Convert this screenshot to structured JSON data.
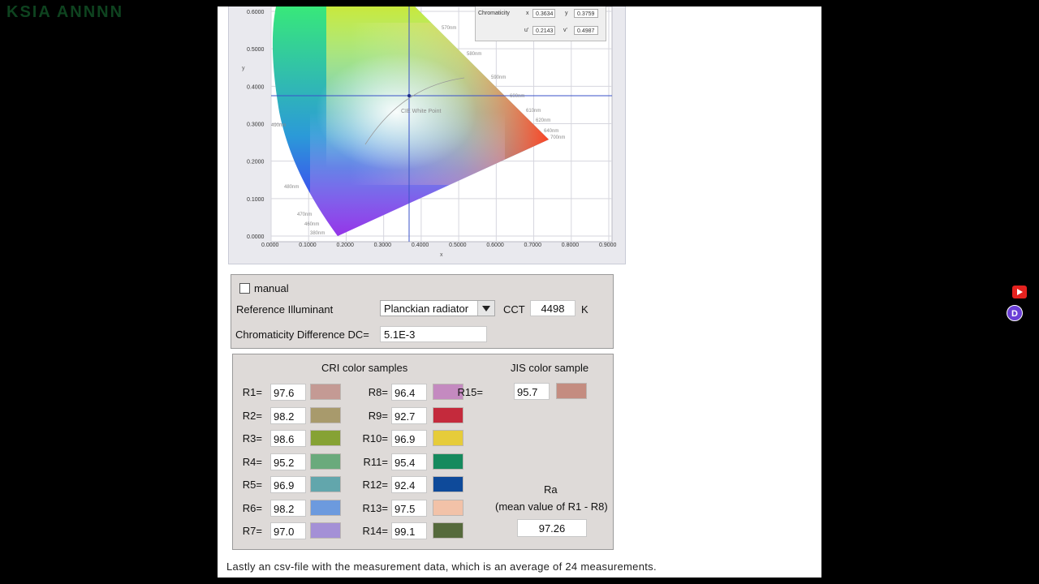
{
  "overlay": {
    "top_left_text": "KSIA ANNNN",
    "d_badge": "D"
  },
  "chart": {
    "y_ticks": [
      "0.6000",
      "0.5000",
      "0.4000",
      "0.3000",
      "0.2000",
      "0.1000",
      "0.0000"
    ],
    "x_ticks": [
      "0.0000",
      "0.1000",
      "0.2000",
      "0.3000",
      "0.4000",
      "0.5000",
      "0.6000",
      "0.7000",
      "0.8000",
      "0.9000"
    ],
    "y_label": "y",
    "x_label": "x",
    "white_point_label": "CIE White Point",
    "wavelengths": [
      "570nm",
      "580nm",
      "590nm",
      "600nm",
      "610nm",
      "620nm",
      "640nm",
      "700nm",
      "490nm",
      "480nm",
      "470nm",
      "460nm",
      "380nm"
    ],
    "readout": {
      "label": "Chromaticity",
      "x_label": "x",
      "x_value": "0.3634",
      "y_label": "y",
      "y_value": "0.3759",
      "u_label": "u'",
      "u_value": "0.2143",
      "v_label": "v'",
      "v_value": "0.4987"
    }
  },
  "illuminant": {
    "manual_label": "manual",
    "manual_checked": false,
    "reference_label": "Reference Illuminant",
    "reference_value": "Planckian radiator",
    "cct_label": "CCT",
    "cct_value": "4498",
    "cct_unit": "K",
    "dc_label": "Chromaticity Difference DC=",
    "dc_value": "5.1E-3"
  },
  "samples": {
    "cri_heading": "CRI color samples",
    "jis_heading": "JIS color sample",
    "cri_left": [
      {
        "label": "R1=",
        "value": "97.6",
        "color": "#c49a94"
      },
      {
        "label": "R2=",
        "value": "98.2",
        "color": "#a89a6c"
      },
      {
        "label": "R3=",
        "value": "98.6",
        "color": "#86a234"
      },
      {
        "label": "R4=",
        "value": "95.2",
        "color": "#6aaa7c"
      },
      {
        "label": "R5=",
        "value": "96.9",
        "color": "#62a6ac"
      },
      {
        "label": "R6=",
        "value": "98.2",
        "color": "#6c9ade"
      },
      {
        "label": "R7=",
        "value": "97.0",
        "color": "#a490d6"
      }
    ],
    "cri_right": [
      {
        "label": "R8=",
        "value": "96.4",
        "color": "#c48ac0"
      },
      {
        "label": "R9=",
        "value": "92.7",
        "color": "#c42a3c"
      },
      {
        "label": "R10=",
        "value": "96.9",
        "color": "#e6cc3a"
      },
      {
        "label": "R11=",
        "value": "95.4",
        "color": "#168a5e"
      },
      {
        "label": "R12=",
        "value": "92.4",
        "color": "#0e4a9a"
      },
      {
        "label": "R13=",
        "value": "97.5",
        "color": "#f2c2a8"
      },
      {
        "label": "R14=",
        "value": "99.1",
        "color": "#566a3c"
      }
    ],
    "jis": {
      "label": "R15=",
      "value": "95.7",
      "color": "#c48c80"
    },
    "ra_label": "Ra",
    "ra_desc": "(mean value of R1 - R8)",
    "ra_value": "97.26"
  },
  "caption": "Lastly an csv-file with the measurement data, which is an average of 24 measurements."
}
